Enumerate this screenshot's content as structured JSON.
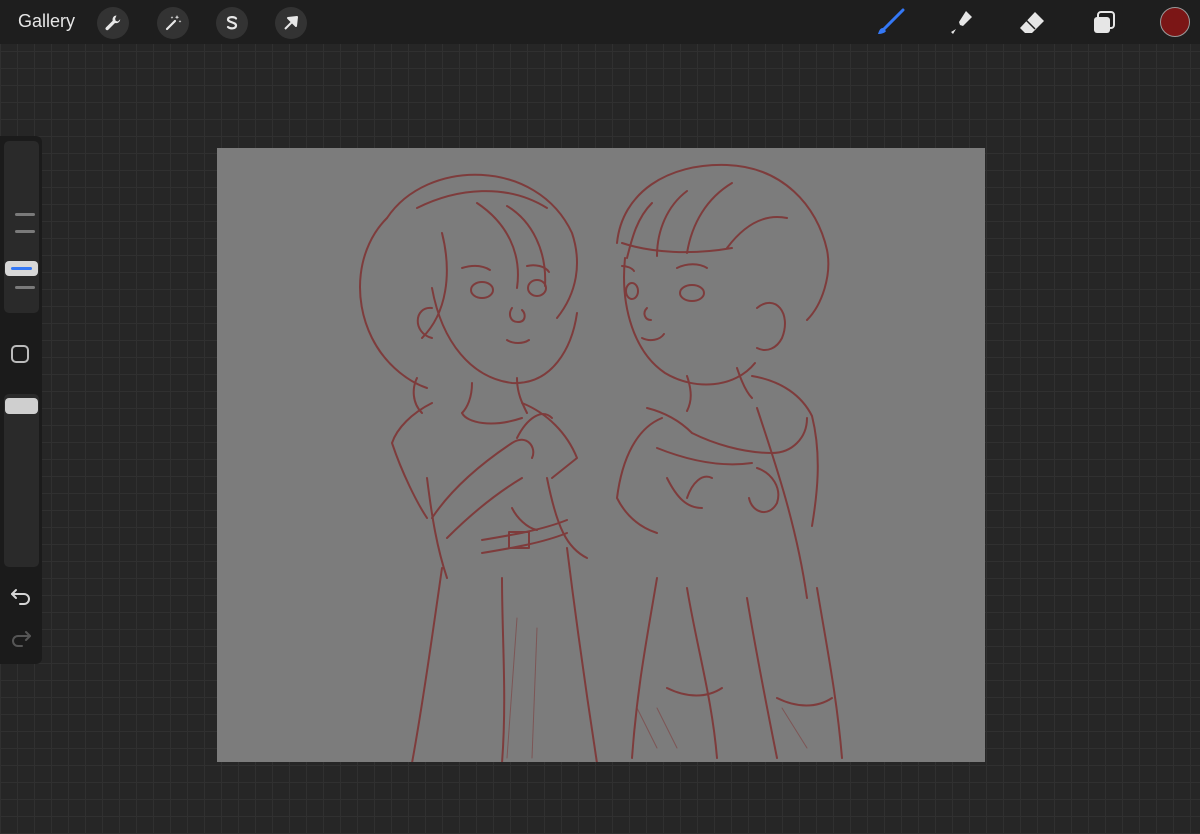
{
  "topbar": {
    "gallery_label": "Gallery",
    "left_tools": [
      "wrench-icon",
      "magic-wand-icon",
      "selection-s-icon",
      "transform-arrow-icon"
    ],
    "right_tools": [
      "brush-icon",
      "smudge-icon",
      "eraser-icon",
      "layers-icon"
    ],
    "active_tool": "brush",
    "current_color": "#7b1616"
  },
  "sidebar": {
    "brush_size_level": 0.3,
    "opacity_level": 0.06
  },
  "colors": {
    "accent": "#3478f6",
    "sketch": "#7e3c3c",
    "canvas": "#7c7c7c"
  }
}
